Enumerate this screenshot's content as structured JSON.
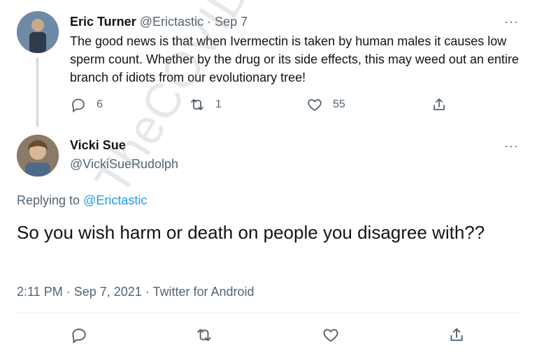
{
  "parent_tweet": {
    "author_name": "Eric Turner",
    "handle": "@Erictastic",
    "separator": "·",
    "date": "Sep 7",
    "text": "The good news is that when Ivermectin is taken by human males it causes low sperm count. Whether by the drug or its side effects, this may weed out an entire branch of idiots from our evolutionary tree!",
    "reply_count": "6",
    "retweet_count": "1",
    "like_count": "55",
    "more_label": "···"
  },
  "main_tweet": {
    "author_name": "Vicki Sue",
    "handle": "@VickiSueRudolph",
    "replying_prefix": "Replying to",
    "replying_handle": "@Erictastic",
    "text": "So you wish harm or death on people you disagree with??",
    "timestamp": "2:11 PM · Sep 7, 2021 · Twitter for Android",
    "more_label": "···"
  },
  "watermark": "TheCOVIDBlog.com",
  "icons": [
    "reply-icon",
    "retweet-icon",
    "like-icon",
    "share-icon",
    "more-icon"
  ],
  "colors": {
    "link": "#1d9bf0",
    "secondary": "#536471",
    "text": "#0f1419"
  }
}
